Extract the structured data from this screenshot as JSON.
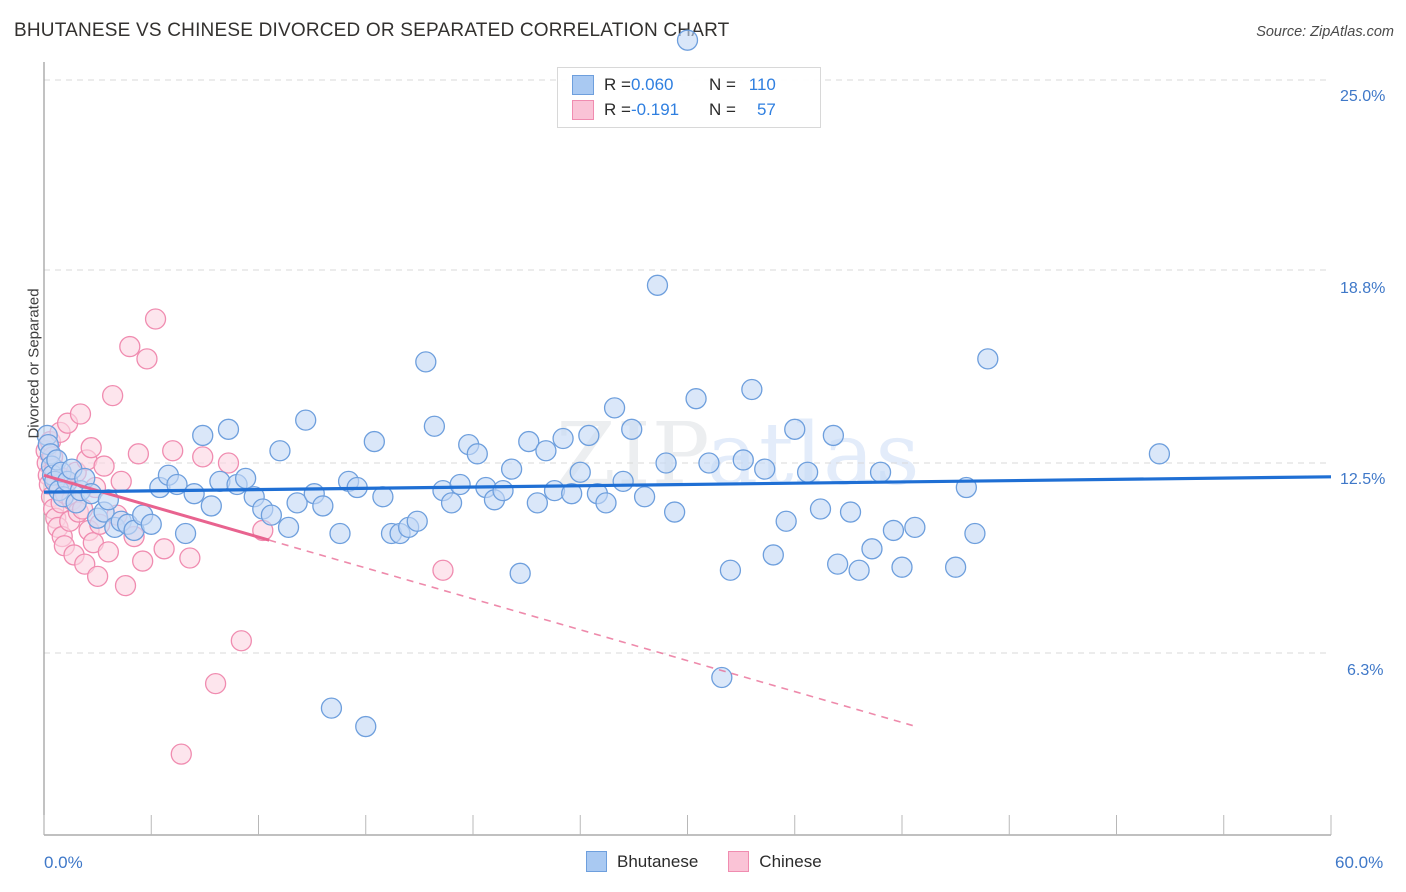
{
  "header": {
    "title": "BHUTANESE VS CHINESE DIVORCED OR SEPARATED CORRELATION CHART",
    "source": "Source: ZipAtlas.com"
  },
  "watermark": {
    "part1": "ZIP",
    "part2": "atlas"
  },
  "stats": {
    "rows": [
      {
        "series": "Bhutanese",
        "r_label": "R = ",
        "r_value": "0.060",
        "n_label": "N = ",
        "n_value": "110",
        "color": "#a9c9f2"
      },
      {
        "series": "Chinese",
        "r_label": "R = ",
        "r_value": "-0.191",
        "n_label": "N = ",
        "n_value": "57",
        "color": "#fac3d6"
      }
    ]
  },
  "legend": {
    "items": [
      {
        "label": "Bhutanese",
        "color": "#a9c9f2",
        "border": "#6e9fdd"
      },
      {
        "label": "Chinese",
        "color": "#fac3d6",
        "border": "#f08cb0"
      }
    ]
  },
  "axes": {
    "y_title": "Divorced or Separated",
    "y_ticks": [
      "25.0%",
      "18.8%",
      "12.5%",
      "6.3%"
    ],
    "x_min_label": "0.0%",
    "x_max_label": "60.0%"
  },
  "chart_data": {
    "type": "scatter",
    "title": "BHUTANESE VS CHINESE DIVORCED OR SEPARATED CORRELATION CHART",
    "xlabel": "",
    "ylabel": "Divorced or Separated",
    "xlim": [
      0,
      60
    ],
    "ylim": [
      0,
      27.4
    ],
    "x_unit": "%",
    "y_unit": "%",
    "grid": true,
    "gridlines_y": [
      25.0,
      18.8,
      12.5,
      6.3
    ],
    "legend_position": "bottom-center",
    "series": [
      {
        "name": "Bhutanese",
        "color": "#c3d9f6",
        "stroke": "#6e9fdd",
        "R": 0.06,
        "N": 110,
        "trend": {
          "type": "linear",
          "x0": 0,
          "y0": 11.55,
          "x1": 60,
          "y1": 12.05,
          "style": "solid",
          "color": "#1f6fd4"
        },
        "points": [
          [
            0.15,
            13.4
          ],
          [
            0.2,
            13.1
          ],
          [
            0.3,
            12.8
          ],
          [
            0.35,
            12.4
          ],
          [
            0.4,
            12.1
          ],
          [
            0.5,
            11.9
          ],
          [
            0.6,
            12.6
          ],
          [
            0.7,
            11.6
          ],
          [
            0.8,
            12.2
          ],
          [
            0.9,
            11.4
          ],
          [
            1.1,
            11.9
          ],
          [
            1.3,
            12.3
          ],
          [
            1.5,
            11.2
          ],
          [
            1.7,
            11.6
          ],
          [
            1.9,
            12.0
          ],
          [
            2.2,
            11.5
          ],
          [
            2.5,
            10.7
          ],
          [
            2.8,
            10.9
          ],
          [
            3.0,
            11.3
          ],
          [
            3.3,
            10.4
          ],
          [
            3.6,
            10.6
          ],
          [
            3.9,
            10.5
          ],
          [
            4.2,
            10.3
          ],
          [
            4.6,
            10.8
          ],
          [
            5.0,
            10.5
          ],
          [
            5.4,
            11.7
          ],
          [
            5.8,
            12.1
          ],
          [
            6.2,
            11.8
          ],
          [
            6.6,
            10.2
          ],
          [
            7.0,
            11.5
          ],
          [
            7.4,
            13.4
          ],
          [
            7.8,
            11.1
          ],
          [
            8.2,
            11.9
          ],
          [
            8.6,
            13.6
          ],
          [
            9.0,
            11.8
          ],
          [
            9.4,
            12.0
          ],
          [
            9.8,
            11.4
          ],
          [
            10.2,
            11.0
          ],
          [
            10.6,
            10.8
          ],
          [
            11.0,
            12.9
          ],
          [
            11.4,
            10.4
          ],
          [
            11.8,
            11.2
          ],
          [
            12.2,
            13.9
          ],
          [
            12.6,
            11.5
          ],
          [
            13.0,
            11.1
          ],
          [
            13.4,
            4.5
          ],
          [
            13.8,
            10.2
          ],
          [
            14.2,
            11.9
          ],
          [
            14.6,
            11.7
          ],
          [
            15.0,
            3.9
          ],
          [
            15.4,
            13.2
          ],
          [
            15.8,
            11.4
          ],
          [
            16.2,
            10.2
          ],
          [
            16.6,
            10.2
          ],
          [
            17.0,
            10.4
          ],
          [
            17.4,
            10.6
          ],
          [
            17.8,
            15.8
          ],
          [
            18.2,
            13.7
          ],
          [
            18.6,
            11.6
          ],
          [
            19.0,
            11.2
          ],
          [
            19.4,
            11.8
          ],
          [
            19.8,
            13.1
          ],
          [
            20.2,
            12.8
          ],
          [
            20.6,
            11.7
          ],
          [
            21.0,
            11.3
          ],
          [
            21.4,
            11.6
          ],
          [
            21.8,
            12.3
          ],
          [
            22.2,
            8.9
          ],
          [
            22.6,
            13.2
          ],
          [
            23.0,
            11.2
          ],
          [
            23.4,
            12.9
          ],
          [
            23.8,
            11.6
          ],
          [
            24.2,
            13.3
          ],
          [
            24.6,
            11.5
          ],
          [
            25.0,
            12.2
          ],
          [
            25.4,
            13.4
          ],
          [
            25.8,
            11.5
          ],
          [
            26.2,
            11.2
          ],
          [
            26.6,
            14.3
          ],
          [
            27.0,
            11.9
          ],
          [
            27.4,
            13.6
          ],
          [
            28.0,
            11.4
          ],
          [
            28.6,
            18.3
          ],
          [
            29.0,
            12.5
          ],
          [
            29.4,
            10.9
          ],
          [
            30.0,
            26.3
          ],
          [
            30.4,
            14.6
          ],
          [
            31.0,
            12.5
          ],
          [
            31.6,
            5.5
          ],
          [
            32.0,
            9.0
          ],
          [
            32.6,
            12.6
          ],
          [
            33.0,
            14.9
          ],
          [
            33.6,
            12.3
          ],
          [
            34.0,
            9.5
          ],
          [
            34.6,
            10.6
          ],
          [
            35.0,
            13.6
          ],
          [
            35.6,
            12.2
          ],
          [
            36.2,
            11.0
          ],
          [
            36.8,
            13.4
          ],
          [
            37.0,
            9.2
          ],
          [
            37.6,
            10.9
          ],
          [
            38.0,
            9.0
          ],
          [
            38.6,
            9.7
          ],
          [
            39.0,
            12.2
          ],
          [
            39.6,
            10.3
          ],
          [
            40.0,
            9.1
          ],
          [
            40.6,
            10.4
          ],
          [
            42.5,
            9.1
          ],
          [
            43.0,
            11.7
          ],
          [
            43.4,
            10.2
          ],
          [
            44.0,
            15.9
          ],
          [
            52.0,
            12.8
          ]
        ]
      },
      {
        "name": "Chinese",
        "color": "#fbd5e2",
        "stroke": "#f08cb0",
        "R": -0.191,
        "N": 57,
        "trend": {
          "type": "linear",
          "x0": 0,
          "y0": 12.1,
          "x1": 60,
          "y1": 0.0,
          "style": "solid-then-dashed",
          "dash_start_x": 10.5,
          "color": "#e8638f"
        },
        "points": [
          [
            0.1,
            12.9
          ],
          [
            0.15,
            12.5
          ],
          [
            0.2,
            12.1
          ],
          [
            0.25,
            11.8
          ],
          [
            0.3,
            13.2
          ],
          [
            0.35,
            11.4
          ],
          [
            0.4,
            12.7
          ],
          [
            0.45,
            11.0
          ],
          [
            0.5,
            12.3
          ],
          [
            0.55,
            10.7
          ],
          [
            0.6,
            11.9
          ],
          [
            0.65,
            10.4
          ],
          [
            0.7,
            11.6
          ],
          [
            0.75,
            13.5
          ],
          [
            0.8,
            11.2
          ],
          [
            0.85,
            10.1
          ],
          [
            0.9,
            12.0
          ],
          [
            0.95,
            9.8
          ],
          [
            1.0,
            11.5
          ],
          [
            1.1,
            13.8
          ],
          [
            1.2,
            10.6
          ],
          [
            1.3,
            11.3
          ],
          [
            1.4,
            9.5
          ],
          [
            1.5,
            12.2
          ],
          [
            1.6,
            10.9
          ],
          [
            1.7,
            14.1
          ],
          [
            1.8,
            11.0
          ],
          [
            1.9,
            9.2
          ],
          [
            2.0,
            12.6
          ],
          [
            2.1,
            10.3
          ],
          [
            2.2,
            13.0
          ],
          [
            2.3,
            9.9
          ],
          [
            2.4,
            11.7
          ],
          [
            2.5,
            8.8
          ],
          [
            2.6,
            10.5
          ],
          [
            2.8,
            12.4
          ],
          [
            3.0,
            9.6
          ],
          [
            3.2,
            14.7
          ],
          [
            3.4,
            10.8
          ],
          [
            3.6,
            11.9
          ],
          [
            3.8,
            8.5
          ],
          [
            4.0,
            16.3
          ],
          [
            4.2,
            10.1
          ],
          [
            4.4,
            12.8
          ],
          [
            4.6,
            9.3
          ],
          [
            4.8,
            15.9
          ],
          [
            5.2,
            17.2
          ],
          [
            5.6,
            9.7
          ],
          [
            6.0,
            12.9
          ],
          [
            6.4,
            3.0
          ],
          [
            6.8,
            9.4
          ],
          [
            7.4,
            12.7
          ],
          [
            8.0,
            5.3
          ],
          [
            8.6,
            12.5
          ],
          [
            9.2,
            6.7
          ],
          [
            10.2,
            10.3
          ],
          [
            18.6,
            9.0
          ]
        ]
      }
    ]
  }
}
